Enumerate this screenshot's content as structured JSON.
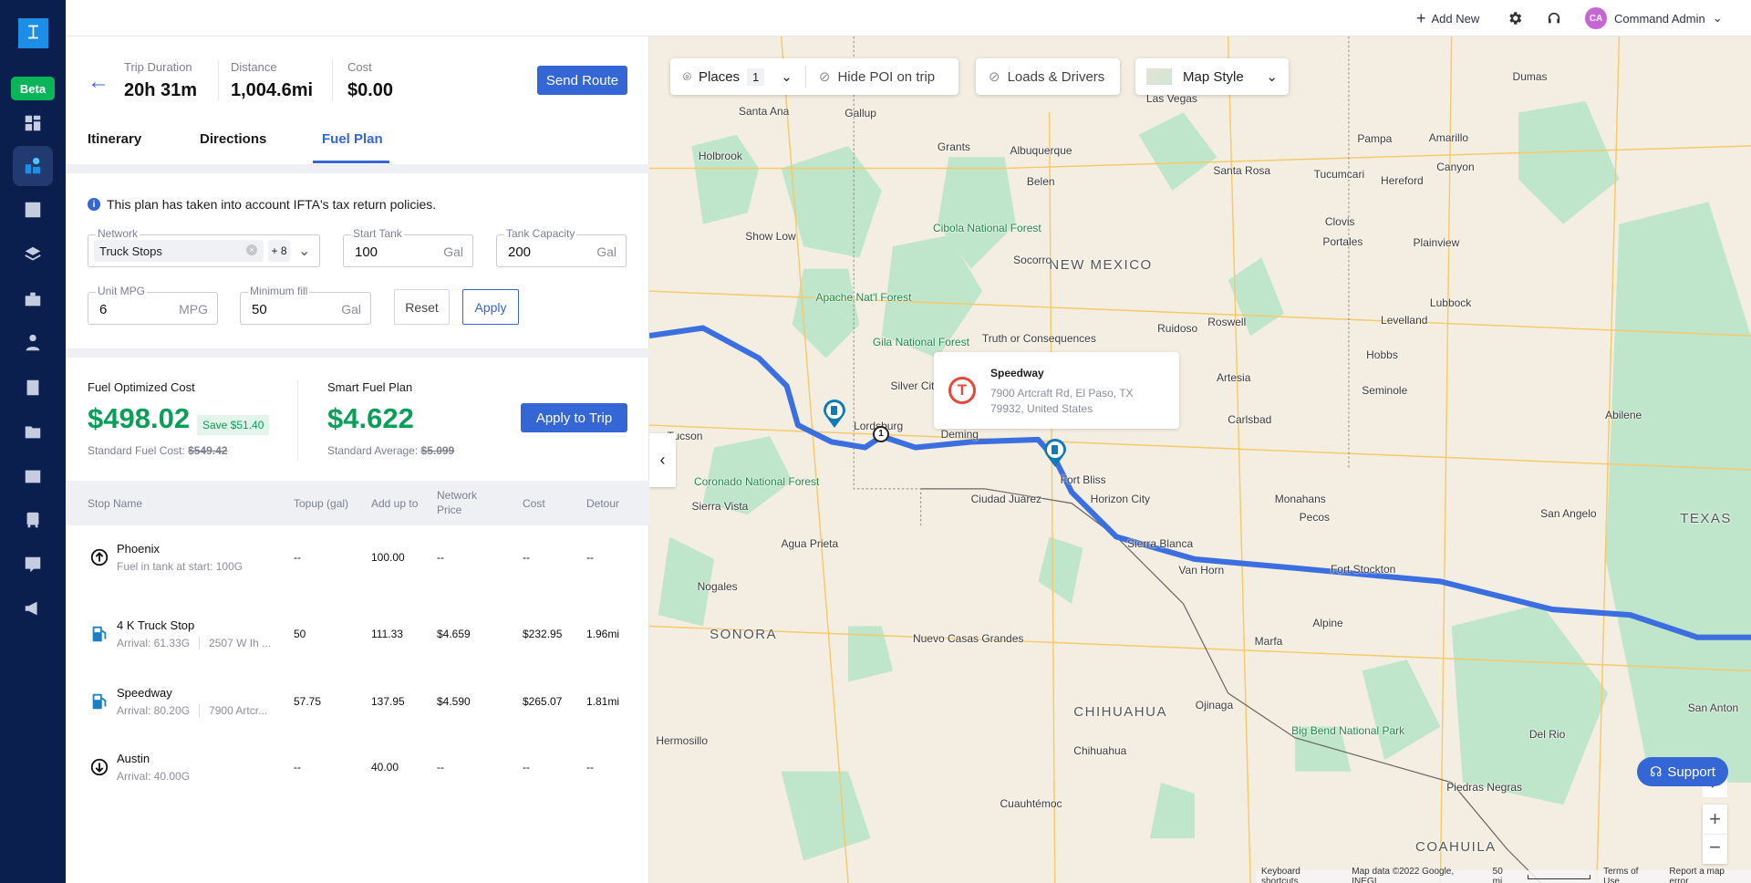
{
  "sidebar": {
    "logo": "logo-icon",
    "beta": "Beta",
    "items": [
      {
        "icon": "dashboard-icon"
      },
      {
        "icon": "route-planner-icon",
        "active": true
      },
      {
        "icon": "dispatch-icon"
      },
      {
        "icon": "layers-icon"
      },
      {
        "icon": "briefcase-icon"
      },
      {
        "icon": "driver-icon"
      },
      {
        "icon": "contacts-icon"
      },
      {
        "icon": "folder-icon"
      },
      {
        "icon": "wallet-icon"
      },
      {
        "icon": "truck-icon"
      },
      {
        "icon": "messages-icon"
      },
      {
        "icon": "announcement-icon"
      }
    ]
  },
  "topbar": {
    "add_new": "Add New",
    "user_initials": "CA",
    "user_name": "Command Admin",
    "avatar_color": "#c864d6"
  },
  "summary": {
    "trip_duration_label": "Trip Duration",
    "trip_duration": "20h 31m",
    "distance_label": "Distance",
    "distance": "1,004.6mi",
    "cost_label": "Cost",
    "cost": "$0.00",
    "send_route": "Send Route"
  },
  "tabs": [
    {
      "label": "Itinerary"
    },
    {
      "label": "Directions"
    },
    {
      "label": "Fuel Plan",
      "active": true
    }
  ],
  "fuel_form": {
    "info": "This plan has taken into account IFTA's tax return policies.",
    "network": {
      "label": "Network",
      "value": "Truck Stops",
      "more": "+ 8"
    },
    "start_tank": {
      "label": "Start Tank",
      "value": "100",
      "unit": "Gal"
    },
    "tank_capacity": {
      "label": "Tank Capacity",
      "value": "200",
      "unit": "Gal"
    },
    "unit_mpg": {
      "label": "Unit MPG",
      "value": "6",
      "unit": "MPG"
    },
    "minimum_fill": {
      "label": "Minimum fill",
      "value": "50",
      "unit": "Gal"
    },
    "reset": "Reset",
    "apply": "Apply"
  },
  "fuel_summary": {
    "optimized_label": "Fuel Optimized Cost",
    "optimized_value": "$498.02",
    "save": "Save $51.40",
    "standard_cost_label": "Standard Fuel Cost:",
    "standard_cost": "$549.42",
    "smart_label": "Smart Fuel Plan",
    "smart_value": "$4.622",
    "standard_avg_label": "Standard Average:",
    "standard_avg": "$5.099",
    "apply_to_trip": "Apply to Trip",
    "accent": "#0a9f58"
  },
  "table": {
    "headers": [
      "Stop Name",
      "Topup (gal)",
      "Add up to",
      "Network Price",
      "Cost",
      "Detour"
    ],
    "rows": [
      {
        "icon": "start-arrow-up-icon",
        "name": "Phoenix",
        "sub1": "Fuel in tank at start: 100G",
        "sub2": "",
        "topup": "--",
        "add_up_to": "100.00",
        "price": "--",
        "cost": "--",
        "detour": "--"
      },
      {
        "icon": "fuel-pump-icon",
        "name": "4 K Truck Stop",
        "sub1": "Arrival: 61.33G",
        "sub2": "2507 W Ih ...",
        "topup": "50",
        "add_up_to": "111.33",
        "price": "$4.659",
        "cost": "$232.95",
        "detour": "1.96mi"
      },
      {
        "icon": "fuel-pump-icon",
        "name": "Speedway",
        "sub1": "Arrival: 80.20G",
        "sub2": "7900 Artcr...",
        "topup": "57.75",
        "add_up_to": "137.95",
        "price": "$4.590",
        "cost": "$265.07",
        "detour": "1.81mi"
      },
      {
        "icon": "end-arrow-down-icon",
        "name": "Austin",
        "sub1": "Arrival: 40.00G",
        "sub2": "",
        "topup": "--",
        "add_up_to": "40.00",
        "price": "--",
        "cost": "--",
        "detour": "--"
      }
    ]
  },
  "map": {
    "places_label": "Places",
    "places_count": "1",
    "hide_poi": "Hide POI on trip",
    "loads_drivers": "Loads & Drivers",
    "map_style": "Map Style",
    "popup": {
      "title": "Speedway",
      "address_line1": "7900 Artcraft Rd, El Paso, TX",
      "address_line2": "79932, United States",
      "brand_color": "#e8483b"
    },
    "waypoint_marker": "1",
    "support": "Support",
    "attribution": {
      "shortcuts": "Keyboard shortcuts",
      "data": "Map data ©2022 Google, INEGI",
      "scale": "50 mi",
      "terms": "Terms of Use",
      "report": "Report a map error"
    },
    "route_color": "#3b6fe0",
    "labels": [
      "Albuquerque",
      "NEW MEXICO",
      "TEXAS",
      "Ciudad Juárez",
      "Tucson",
      "Lordsburg",
      "Deming",
      "Fort Bliss",
      "Horizon City",
      "Sierra Blanca",
      "Van Horn",
      "Fort Stockton",
      "Pecos",
      "Alpine",
      "Marfa",
      "San Anton",
      "CHIHUAHUA",
      "SONORA",
      "Hermosillo",
      "Amarillo",
      "Lubbock",
      "Roswell",
      "Carlsbad",
      "Monahans",
      "Big Bend National Park",
      "Las Vegas",
      "Socorro",
      "Gallup",
      "Holbrook",
      "Show Low",
      "Silver City",
      "Truth or Consequences",
      "Cibola National Forest",
      "Gila National Forest",
      "Apache Nat'l Forest",
      "Coronado National Forest",
      "Agua Prieta",
      "Nuevo Casas Grandes",
      "Ojinaga",
      "Cuauhtémoc",
      "Chihuahua",
      "Abilene",
      "San Angelo",
      "Del Rio",
      "Piedras Negras",
      "COAHUILA",
      "Santa Rosa",
      "Tucumcari",
      "Clovis",
      "Portales",
      "Artesia",
      "Hobbs",
      "Seminole",
      "Sierra Vista",
      "Nogales",
      "Dumas",
      "Canyon",
      "Hereford",
      "Plainview",
      "Levelland",
      "Ruidoso",
      "Belen",
      "Grants",
      "Pampa",
      "Santa Ana"
    ]
  }
}
